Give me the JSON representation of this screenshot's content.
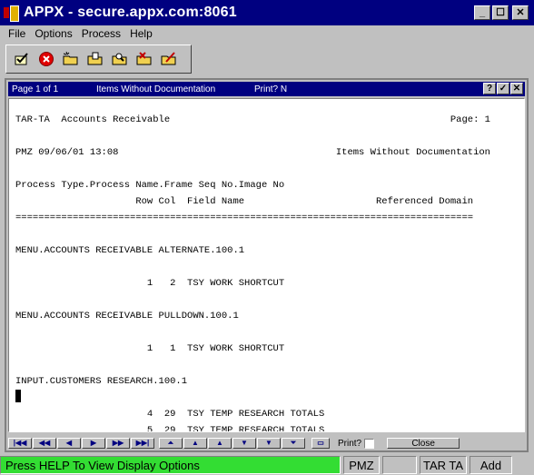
{
  "window": {
    "title": "APPX - secure.appx.com:8061",
    "buttons": {
      "minimize": "_",
      "maximize": "☐",
      "close": "✕"
    }
  },
  "menu": [
    {
      "label": "File"
    },
    {
      "label": "Options"
    },
    {
      "label": "Process"
    },
    {
      "label": "Help"
    }
  ],
  "toolbar": {
    "icons": [
      "check-icon",
      "cancel-icon",
      "new-folder-icon",
      "open-folder-icon",
      "find-folder-icon",
      "delete-folder-icon",
      "edit-folder-icon"
    ]
  },
  "inner_window": {
    "page": "Page 1 of 1",
    "name": "Items Without Documentation",
    "print": "Print? N",
    "buttons": {
      "help": "?",
      "ok": "✓",
      "close": "✕"
    }
  },
  "report": {
    "lines": [
      "TAR-TA  Accounts Receivable                                                 Page: 1",
      "PMZ 09/06/01 13:08                                      Items Without Documentation",
      "Process Type.Process Name.Frame Seq No.Image No",
      "                     Row Col  Field Name                       Referenced Domain",
      "================================================================================",
      "MENU.ACCOUNTS RECEIVABLE ALTERNATE.100.1",
      "                       1   2  TSY WORK SHORTCUT",
      "MENU.ACCOUNTS RECEIVABLE PULLDOWN.100.1",
      "                       1   1  TSY WORK SHORTCUT",
      "INPUT.CUSTOMERS RESEARCH.100.1",
      "                       4  29  TSY TEMP RESEARCH TOTALS",
      "                       5  29  TSY TEMP RESEARCH TOTALS"
    ]
  },
  "nav": {
    "print_label": "Print?",
    "close_label": "Close"
  },
  "status": {
    "message": "Press HELP To View Display Options",
    "user": "PMZ",
    "blank": "",
    "app": "TAR TA",
    "mode": "Add"
  }
}
